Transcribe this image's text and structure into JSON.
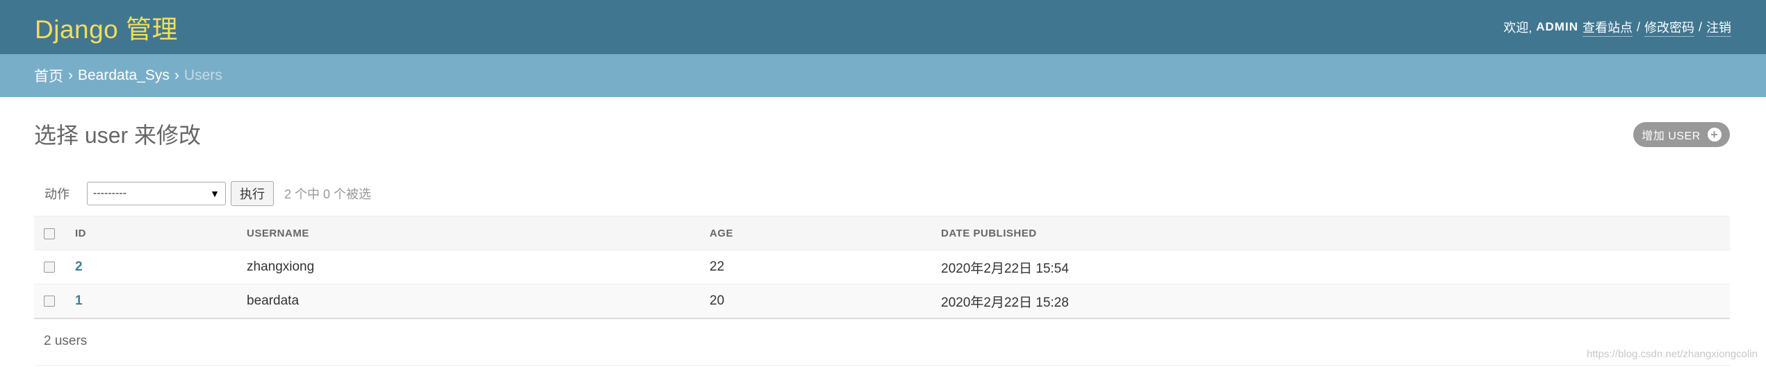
{
  "header": {
    "site_name": "Django 管理",
    "welcome": "欢迎,",
    "username": "ADMIN",
    "view_site": "查看站点",
    "sep1": "/",
    "change_password": "修改密码",
    "sep2": "/",
    "logout": "注销"
  },
  "breadcrumbs": {
    "home": "首页",
    "arrow1": "›",
    "app": "Beardata_Sys",
    "arrow2": "›",
    "current": "Users"
  },
  "page": {
    "title": "选择 user 来修改",
    "add_button": "增加 USER",
    "add_icon": "+"
  },
  "actions": {
    "label": "动作",
    "select_value": "---------",
    "go_button": "执行",
    "counter": "2 个中 0 个被选"
  },
  "table": {
    "columns": [
      "ID",
      "USERNAME",
      "AGE",
      "DATE PUBLISHED"
    ],
    "rows": [
      {
        "id": "2",
        "username": "zhangxiong",
        "age": "22",
        "date_published": "2020年2月22日 15:54"
      },
      {
        "id": "1",
        "username": "beardata",
        "age": "20",
        "date_published": "2020年2月22日 15:28"
      }
    ]
  },
  "paginator": {
    "count": "2 users"
  },
  "watermark": "https://blog.csdn.net/zhangxiongcolin",
  "colors": {
    "header_bg": "#417690",
    "site_name": "#f5dd5d",
    "breadcrumbs_bg": "#79aec8",
    "link": "#447e9b"
  }
}
